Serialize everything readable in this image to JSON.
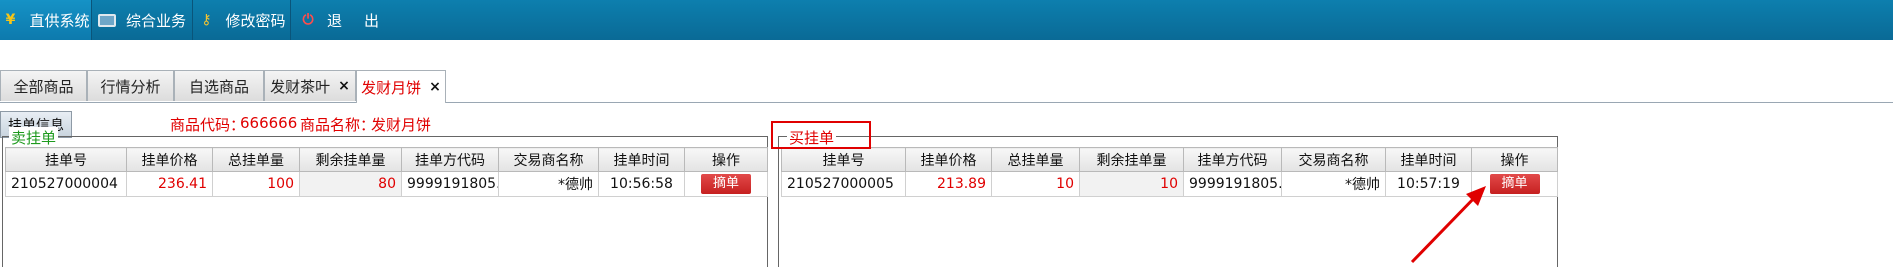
{
  "menu": {
    "items": [
      {
        "label": "直供系统",
        "icon": "yen-icon"
      },
      {
        "label": "综合业务",
        "icon": "monitor-icon"
      },
      {
        "label": "修改密码",
        "icon": "key-icon"
      },
      {
        "label": "退",
        "label2": "出",
        "icon": "power-icon"
      }
    ]
  },
  "tabs": [
    {
      "label": "全部商品"
    },
    {
      "label": "行情分析"
    },
    {
      "label": "自选商品"
    },
    {
      "label": "发财茶叶",
      "close": "×"
    },
    {
      "label": "发财月饼",
      "close": "×"
    }
  ],
  "info": {
    "button_label": "挂单信息",
    "code_label": "商品代码：",
    "code_value": "666666",
    "name_label": "商品名称：",
    "name_value": "发财月饼"
  },
  "columns": [
    "挂单号",
    "挂单价格",
    "总挂单量",
    "剩余挂单量",
    "挂单方代码",
    "交易商名称",
    "挂单时间",
    "操作"
  ],
  "sell": {
    "legend": "卖挂单",
    "rows": [
      {
        "id": "210527000004",
        "price": "236.41",
        "total": "100",
        "remaining": "80",
        "party": "9999191805...",
        "trader": "*德帅",
        "time": "10:56:58",
        "action": "摘单"
      }
    ]
  },
  "buy": {
    "legend": "买挂单",
    "rows": [
      {
        "id": "210527000005",
        "price": "213.89",
        "total": "10",
        "remaining": "10",
        "party": "9999191805...",
        "trader": "*德帅",
        "time": "10:57:19",
        "action": "摘单"
      }
    ]
  },
  "colors": {
    "accent_red": "#e00000",
    "menu_blue": "#0d7fae",
    "legend_green": "#1e9a1e"
  }
}
